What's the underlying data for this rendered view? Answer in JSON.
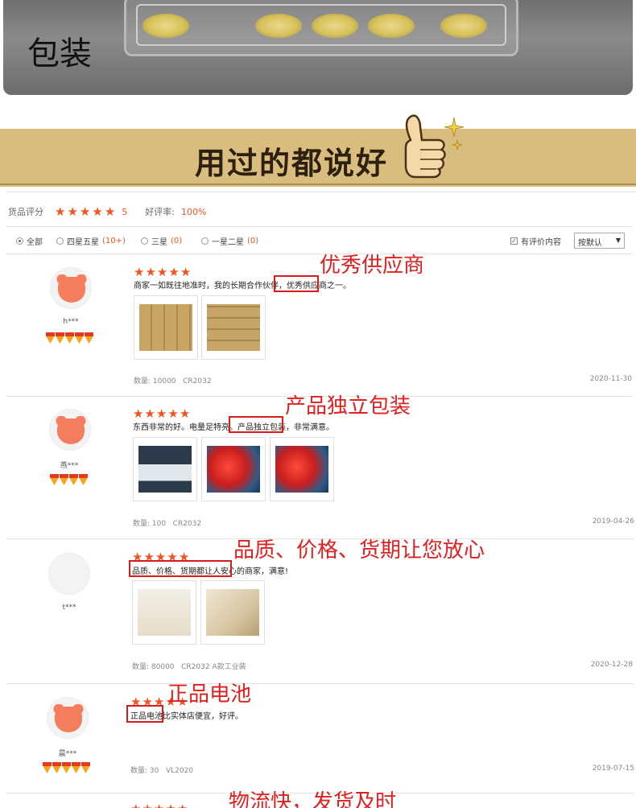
{
  "header": {
    "packaging_title": "包装",
    "banner_title": "用过的都说好",
    "banner_icon": "thumbs-up-icon"
  },
  "summary": {
    "rating_label": "货品评分",
    "rating_value": "5",
    "positive_label": "好评率:",
    "positive_value": "100%",
    "colors": {
      "accent": "#f4521e",
      "annotation": "#e21f1f",
      "banner": "#d9bd7e"
    }
  },
  "filters": {
    "all": "全部",
    "four_five": "四星五星",
    "four_five_count": "(10+)",
    "three": "三星",
    "three_count": "(0)",
    "one_two": "一星二星",
    "one_two_count": "(0)",
    "has_content": "有评价内容",
    "sort": "按默认"
  },
  "reviews": [
    {
      "user": "h***",
      "text": "商家一如既往地准时，我的长期合作伙伴，优秀供应商之一。",
      "annotation": "优秀供应商",
      "quantity": "数量: 10000",
      "model": "CR2032",
      "date": "2020-11-30"
    },
    {
      "user": "燕***",
      "text": "东西非常的好。电量足特亮。产品独立包装，非常满意。",
      "annotation": "产品独立包装",
      "quantity": "数量: 100",
      "model": "CR2032",
      "date": "2019-04-26"
    },
    {
      "user": "t***",
      "text": "品质、价格、货期都让人安心的商家，满意!",
      "annotation": "品质、价格、货期让您放心",
      "quantity": "数量: 80000",
      "model": "CR2032 A款工业装",
      "date": "2020-12-28"
    },
    {
      "user": "晨***",
      "text": "正品电池比实体店便宜，好评。",
      "annotation": "正品电池",
      "quantity": "数量: 30",
      "model": "VL2020",
      "date": "2019-07-15"
    },
    {
      "annotation": "物流快，发货及时"
    }
  ]
}
